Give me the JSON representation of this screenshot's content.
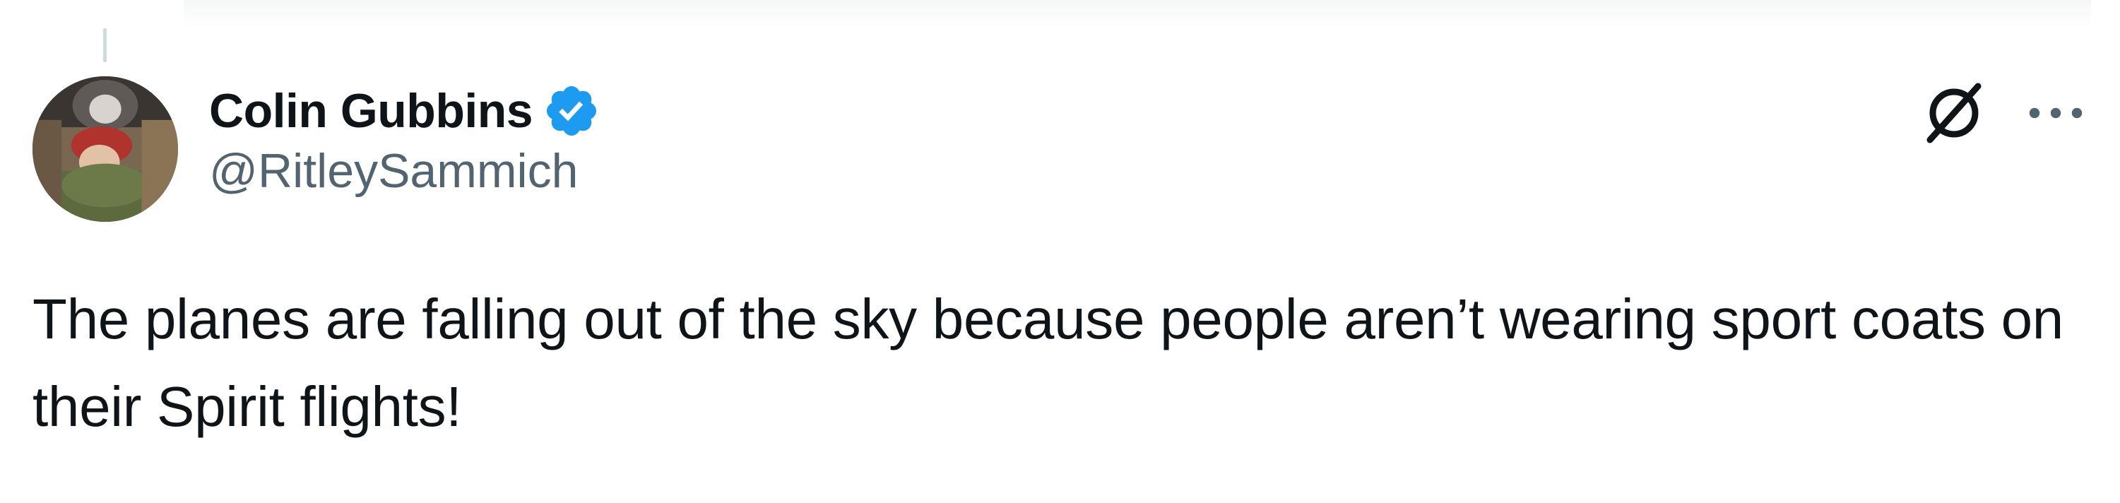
{
  "tweet": {
    "author": {
      "display_name": "Colin Gubbins",
      "handle": "@RitleySammich",
      "verified": true,
      "verified_color": "#1d9bf0"
    },
    "text": "The planes are falling out of the sky because people aren’t wearing sport coats on their Spirit flights!",
    "icons": {
      "grok": "grok-icon",
      "more": "more-options-icon",
      "verified": "verified-badge-icon"
    }
  },
  "colors": {
    "text_primary": "#0f1419",
    "text_secondary": "#536471",
    "accent": "#1d9bf0"
  }
}
